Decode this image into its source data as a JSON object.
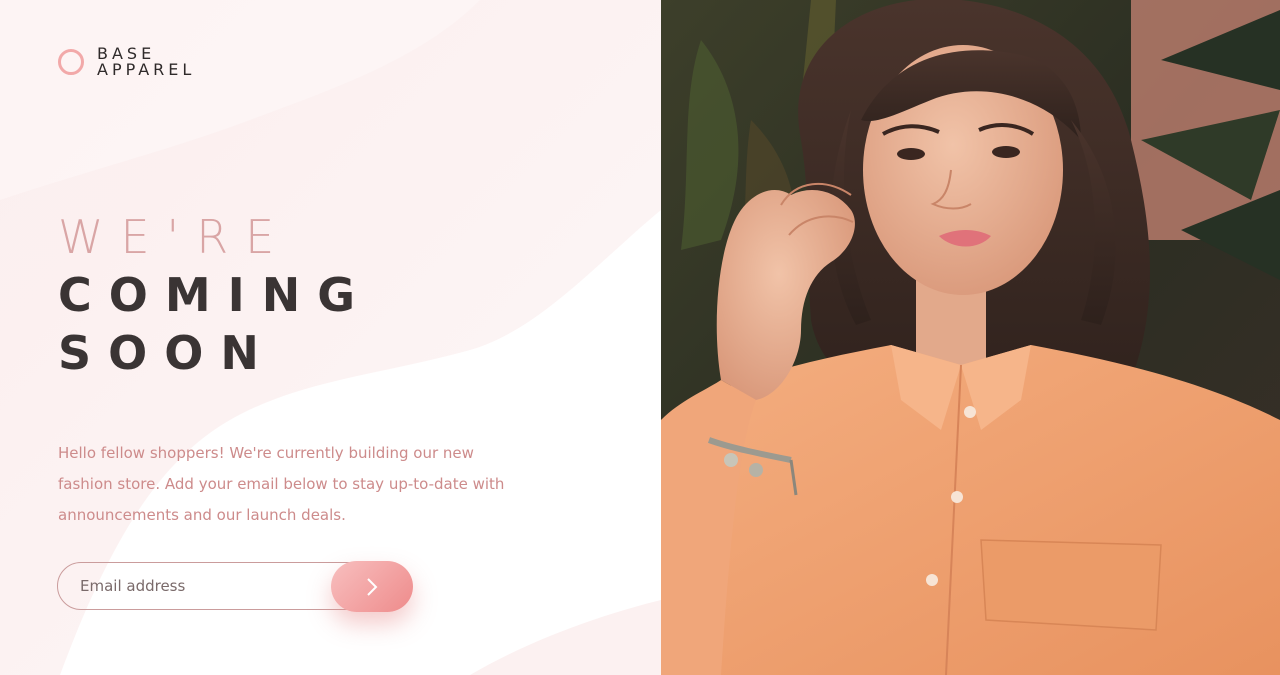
{
  "brand": {
    "line1": "BASE",
    "line2": "APPAREL",
    "accent_color": "#f2a9a9"
  },
  "headline": {
    "line1": "WE'RE",
    "line2": "COMING",
    "line3": "SOON"
  },
  "intro": {
    "text": "Hello fellow shoppers! We're currently building our new fashion store. Add your email below to stay up-to-date with announcements and our launch deals."
  },
  "form": {
    "email_placeholder": "Email address",
    "email_value": "",
    "submit_icon": "chevron-right-icon"
  },
  "hero": {
    "image": "woman-in-orange-shirt-photo"
  },
  "colors": {
    "headline_light": "#d9a5a5",
    "headline_dark": "#3a3434",
    "body_text": "#cd8b8b",
    "button_gradient_start": "#f8bfbf",
    "button_gradient_end": "#ee8b8b"
  }
}
